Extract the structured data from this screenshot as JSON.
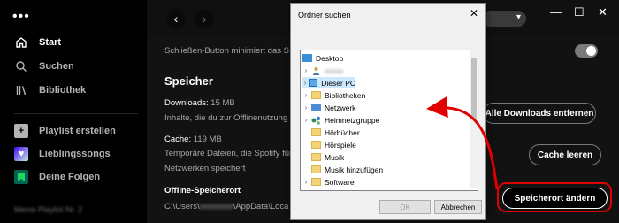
{
  "sidebar": {
    "menu_icon": "more-dots-icon",
    "nav": [
      {
        "label": "Start",
        "icon": "home-icon"
      },
      {
        "label": "Suchen",
        "icon": "search-icon"
      },
      {
        "label": "Bibliothek",
        "icon": "library-icon"
      }
    ],
    "playlists": [
      {
        "label": "Playlist erstellen",
        "icon": "plus-icon"
      },
      {
        "label": "Lieblingssongs",
        "icon": "heart-icon"
      },
      {
        "label": "Deine Folgen",
        "icon": "bookmark-icon"
      }
    ],
    "now_playing": "Meine Playlist Nr. 2"
  },
  "topbar": {
    "back_icon": "chevron-left-icon",
    "forward_icon": "chevron-right-icon",
    "window_controls": [
      "—",
      "☐",
      "✕"
    ]
  },
  "settings": {
    "close_button_text": "Schließen-Button minimiert das S",
    "storage_heading": "Speicher",
    "downloads_label": "Downloads:",
    "downloads_value": "15 MB",
    "downloads_desc": "Inhalte, die du zur Offlinenutzung",
    "remove_downloads_button": "Alle Downloads entfernen",
    "cache_label": "Cache:",
    "cache_value": "119 MB",
    "cache_desc_1": "Temporäre Dateien, die Spotify für",
    "cache_desc_2": "Netzwerken speichert",
    "clear_cache_button": "Cache leeren",
    "offline_heading": "Offline-Speicherort",
    "offline_path_prefix": "C:\\Users\\",
    "offline_path_suffix": "\\AppData\\Loca",
    "change_location_button": "Speicherort ändern"
  },
  "dialog": {
    "title": "Ordner suchen",
    "close_icon": "close-icon",
    "tree": [
      {
        "label": "Desktop",
        "indent": 0,
        "arrow": "",
        "icon": "desktop"
      },
      {
        "label": "",
        "indent": 1,
        "arrow": "›",
        "icon": "user"
      },
      {
        "label": "Dieser PC",
        "indent": 1,
        "arrow": "›",
        "icon": "pc",
        "selected": true
      },
      {
        "label": "Bibliotheken",
        "indent": 1,
        "arrow": "›",
        "icon": "folder"
      },
      {
        "label": "Netzwerk",
        "indent": 1,
        "arrow": "›",
        "icon": "network"
      },
      {
        "label": "Heimnetzgruppe",
        "indent": 1,
        "arrow": "›",
        "icon": "homegroup"
      },
      {
        "label": "Hörbücher",
        "indent": 1,
        "arrow": "",
        "icon": "folder"
      },
      {
        "label": "Hörspiele",
        "indent": 1,
        "arrow": "",
        "icon": "folder"
      },
      {
        "label": "Musik",
        "indent": 1,
        "arrow": "",
        "icon": "folder"
      },
      {
        "label": "Musik hinzufügen",
        "indent": 1,
        "arrow": "",
        "icon": "folder"
      },
      {
        "label": "Software",
        "indent": 1,
        "arrow": "›",
        "icon": "folder"
      }
    ],
    "ok_button": "OK",
    "cancel_button": "Abbrechen"
  },
  "colors": {
    "annotation": "#e00000",
    "background": "#121212",
    "sidebar": "#000000"
  }
}
